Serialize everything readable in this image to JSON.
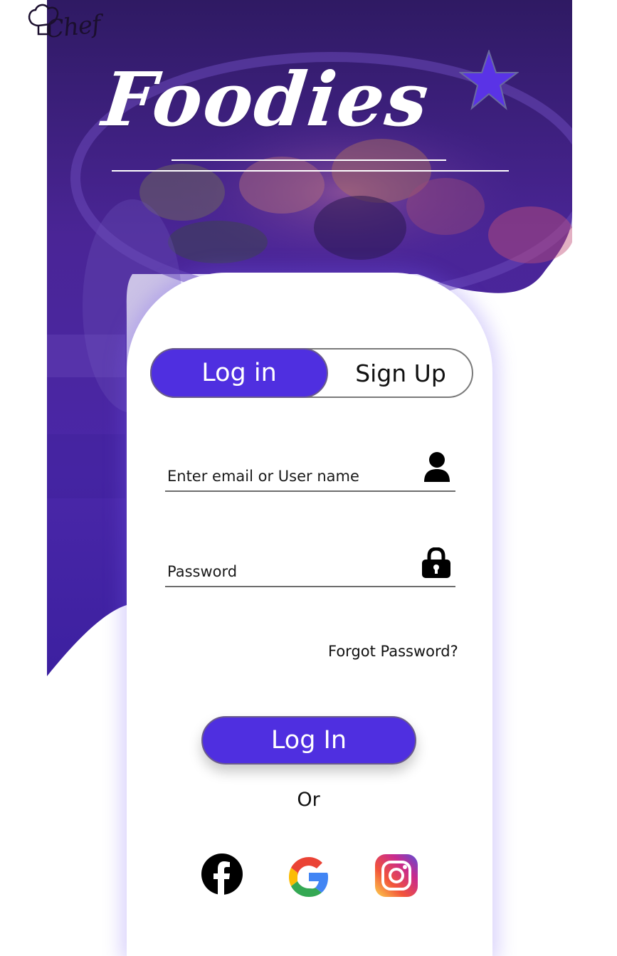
{
  "header": {
    "logo_text": "Chef",
    "brand_title": "Foodies"
  },
  "auth_tabs": {
    "login_label": "Log in",
    "signup_label": "Sign Up",
    "active": "login"
  },
  "form": {
    "email_placeholder": "Enter email or User name",
    "password_placeholder": "Password",
    "forgot_label": "Forgot Password?",
    "submit_label": "Log In",
    "or_label": "Or"
  },
  "social": [
    {
      "name": "facebook-icon"
    },
    {
      "name": "google-icon"
    },
    {
      "name": "instagram-icon"
    }
  ],
  "colors": {
    "accent": "#4f2fe0",
    "hero_purple": "#3d1f8c",
    "star": "#5a33e6"
  },
  "icons": {
    "email_field": "user-icon",
    "password_field": "lock-icon",
    "title_star": "star-icon"
  }
}
